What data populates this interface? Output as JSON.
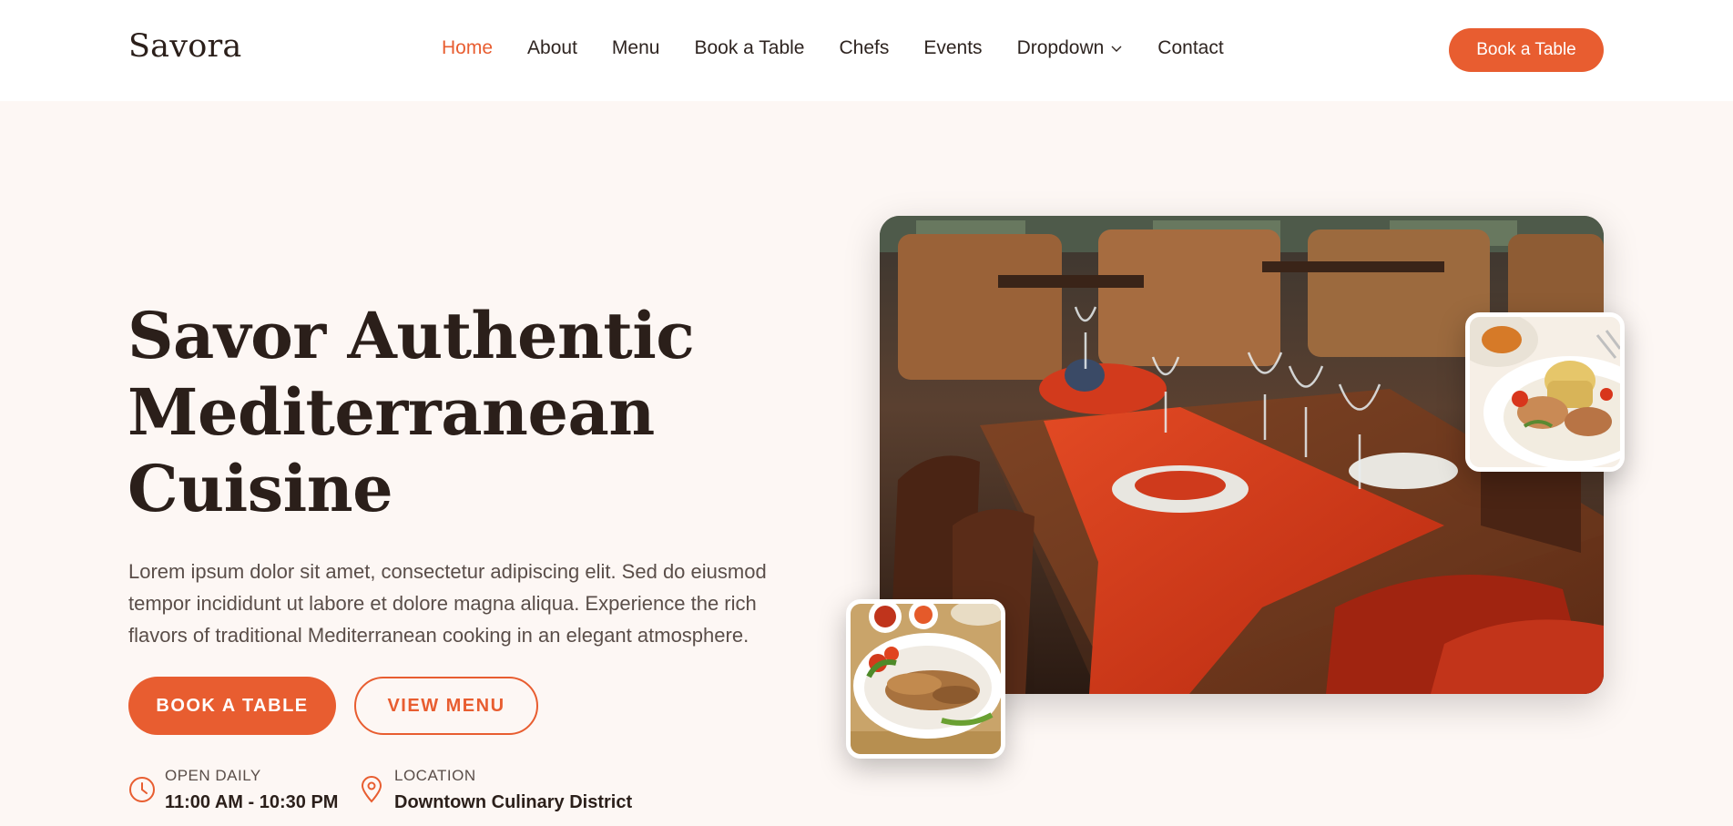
{
  "brand": {
    "name": "Savora",
    "accent": "#e85d30"
  },
  "nav": {
    "items": [
      {
        "label": "Home"
      },
      {
        "label": "About"
      },
      {
        "label": "Menu"
      },
      {
        "label": "Book a Table"
      },
      {
        "label": "Chefs"
      },
      {
        "label": "Events"
      },
      {
        "label": "Dropdown"
      },
      {
        "label": "Contact"
      }
    ],
    "cta_label": "Book a Table"
  },
  "hero": {
    "title_lines": [
      "Savor Authentic",
      "Mediterranean",
      "Cuisine"
    ],
    "description": "Lorem ipsum dolor sit amet, consectetur adipiscing elit. Sed do eiusmod tempor incididunt ut labore et dolore magna aliqua. Experience the rich flavors of traditional Mediterranean cooking in an elegant atmosphere.",
    "primary_button": "BOOK A TABLE",
    "secondary_button": "VIEW MENU"
  },
  "info": {
    "hours": {
      "label": "OPEN DAILY",
      "value": "11:00 AM - 10:30 PM",
      "icon": "clock-icon"
    },
    "location": {
      "label": "LOCATION",
      "value": "Downtown Culinary District",
      "icon": "map-pin-icon"
    }
  }
}
